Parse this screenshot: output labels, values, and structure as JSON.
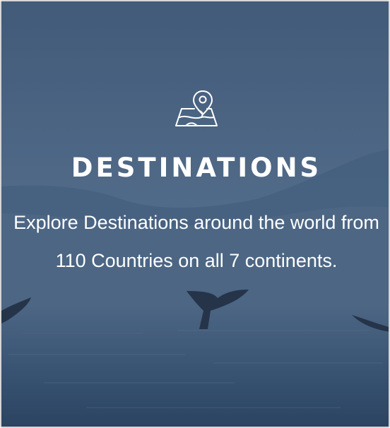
{
  "card": {
    "icon": "map-pin-icon",
    "title": "DESTINATIONS",
    "description": "Explore Destinations around the world from 110 Countries on all 7 continents."
  },
  "colors": {
    "overlay": "#4a6585",
    "text": "#ffffff"
  }
}
